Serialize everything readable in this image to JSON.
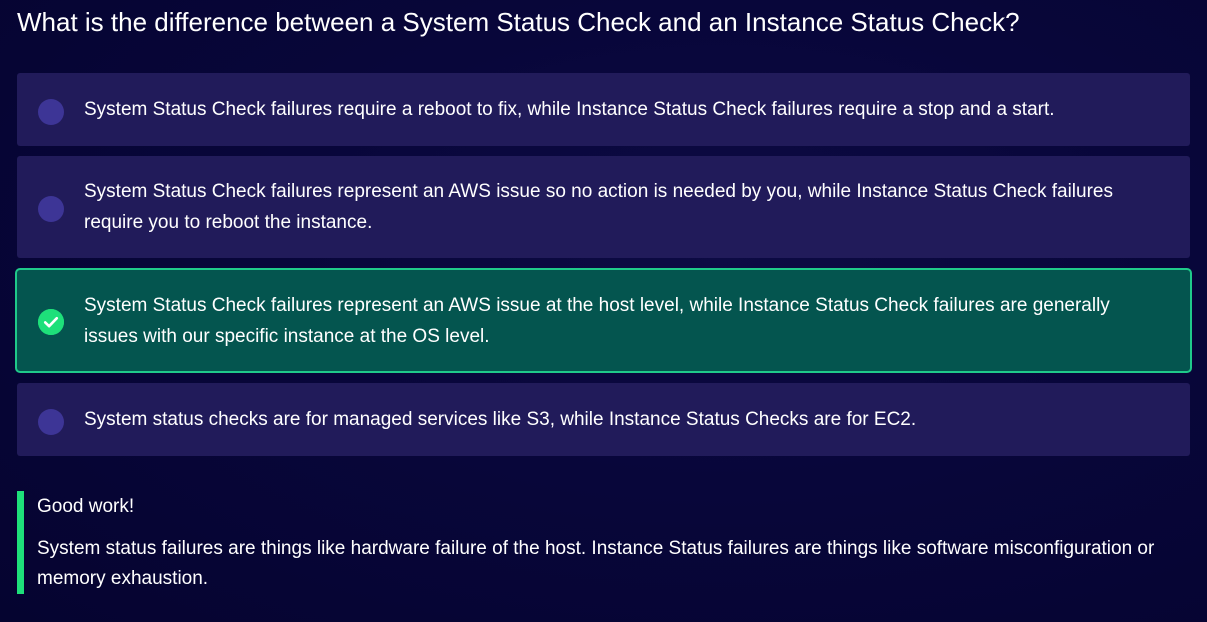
{
  "question": "What is the difference between a System Status Check and an Instance Status Check?",
  "options": [
    {
      "text": "System Status Check failures require a reboot to fix, while Instance Status Check failures require a stop and a start.",
      "selected": false
    },
    {
      "text": "System Status Check failures represent an AWS issue so no action is needed by you, while Instance Status Check failures require you to reboot the instance.",
      "selected": false
    },
    {
      "text": "System Status Check failures represent an AWS issue at the host level, while Instance Status Check failures are generally issues with our specific instance at the OS level.",
      "selected": true
    },
    {
      "text": "System status checks are for managed services like S3, while Instance Status Checks are for EC2.",
      "selected": false
    }
  ],
  "feedback": {
    "title": "Good work!",
    "body": "System status failures are things like hardware failure of the host. Instance Status failures are things like software misconfiguration or memory exhaustion."
  },
  "icons": {
    "selected": "checkmark-circle-icon",
    "unselected": "radio-circle-icon"
  },
  "colors": {
    "option_background": "#211b5a",
    "selected_background": "#04554f",
    "selected_border": "#1fc98a",
    "accent_green": "#1ee07a",
    "radio_unselected": "#3d3596"
  }
}
